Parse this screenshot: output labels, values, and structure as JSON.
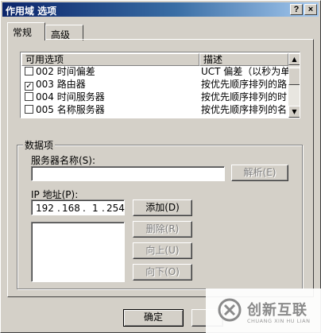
{
  "window": {
    "title": "作用域 选项",
    "help_btn": "?",
    "close_btn": "×"
  },
  "tabs": [
    {
      "label": "常规"
    },
    {
      "label": "高级"
    }
  ],
  "options_list": {
    "headers": [
      "可用选项",
      "描述"
    ],
    "rows": [
      {
        "checked": false,
        "name": "002 时间偏差",
        "desc": "UCT 偏差（以秒为单位"
      },
      {
        "checked": true,
        "name": "003 路由器",
        "desc": "按优先顺序排列的路"
      },
      {
        "checked": false,
        "name": "004 时间服务器",
        "desc": "按优先顺序排列的时"
      },
      {
        "checked": false,
        "name": "005 名称服务器",
        "desc": "按优先顺序排列的名"
      }
    ]
  },
  "data_group": {
    "legend": "数据项",
    "server_name_label": "服务器名称(S):",
    "server_name_value": "",
    "resolve_button": "解析(E)",
    "ip_label": "IP 地址(P):",
    "ip": [
      "192",
      "168",
      "1",
      "254"
    ],
    "add_button": "添加(D)",
    "remove_button": "删除(R)",
    "up_button": "向上(U)",
    "down_button": "向下(O)"
  },
  "footer": {
    "ok_button": "确定"
  },
  "watermark": {
    "name": "创新互联",
    "sub": "CHUANG XIN HU LIAN"
  },
  "colors": {
    "title_start": "#0a246a",
    "title_end": "#a6caf0",
    "face": "#d4d0c8",
    "watermark": "#8a8a8a"
  }
}
